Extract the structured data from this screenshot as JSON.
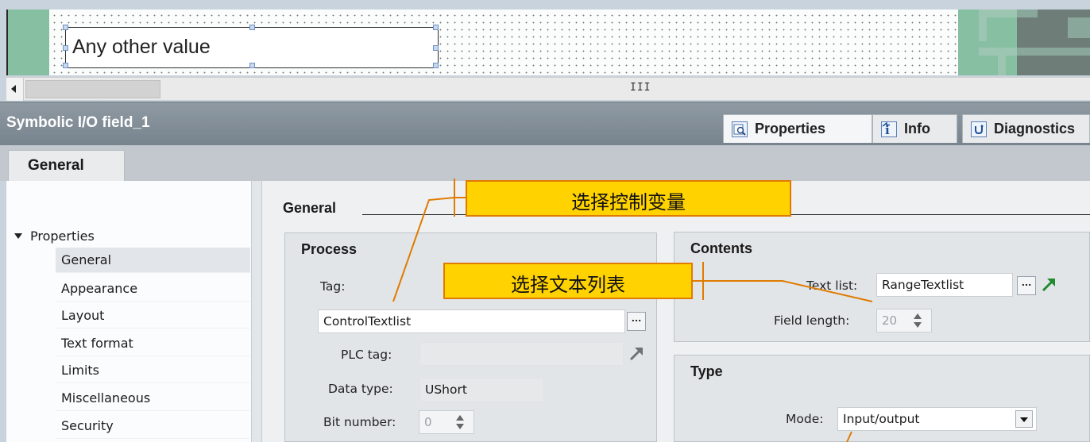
{
  "canvas": {
    "io_field_text": "Any other value"
  },
  "scrollbar": {
    "grip": "III"
  },
  "inspector": {
    "title": "Symbolic I/O field_1",
    "tabs": [
      {
        "label": "Properties",
        "icon": "properties-icon"
      },
      {
        "label": "Info",
        "icon": "info-icon"
      },
      {
        "label": "Diagnostics",
        "icon": "diagnostics-icon"
      }
    ]
  },
  "subtab": {
    "label": "General"
  },
  "nav": {
    "header": "Properties",
    "items": [
      {
        "label": "General",
        "selected": true
      },
      {
        "label": "Appearance"
      },
      {
        "label": "Layout"
      },
      {
        "label": "Text format"
      },
      {
        "label": "Limits"
      },
      {
        "label": "Miscellaneous"
      },
      {
        "label": "Security"
      }
    ]
  },
  "main": {
    "heading": "General",
    "process": {
      "title": "Process",
      "tag_label": "Tag:",
      "tag_value": "ControlTextlist",
      "ellipsis": "...",
      "plc_tag_label": "PLC tag:",
      "plc_tag_value": "",
      "data_type_label": "Data type:",
      "data_type_value": "UShort",
      "bit_number_label": "Bit number:",
      "bit_number_value": "0"
    },
    "contents": {
      "title": "Contents",
      "text_list_label": "Text list:",
      "text_list_value": "RangeTextlist",
      "ellipsis": "...",
      "field_length_label": "Field length:",
      "field_length_value": "20"
    },
    "type": {
      "title": "Type",
      "mode_label": "Mode:",
      "mode_value": "Input/output"
    }
  },
  "callouts": {
    "tag": "选择控制变量",
    "text_list": "选择文本列表"
  },
  "colors": {
    "callout_fill": "#ffd200",
    "callout_border": "#e07b00",
    "canvas_green": "#87bfa3",
    "inspector_bar": "#838e97",
    "goto_arrow": "#1f8a2e"
  }
}
